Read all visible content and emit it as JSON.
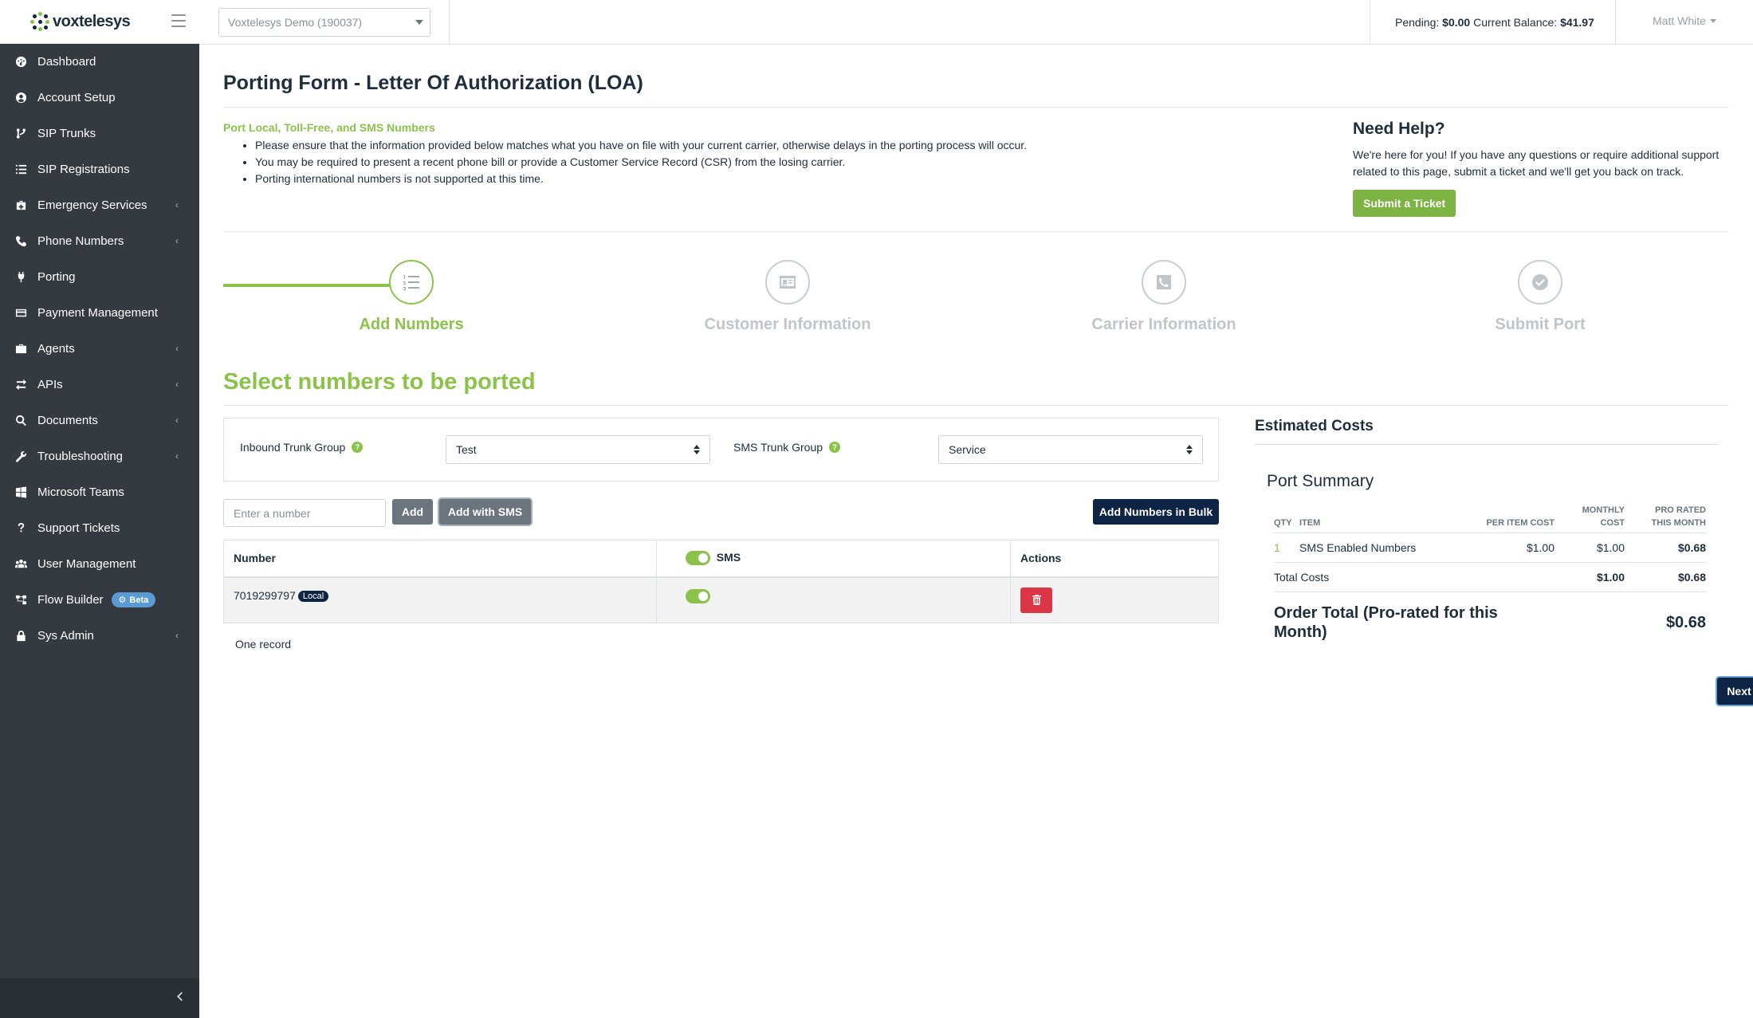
{
  "brand": {
    "name_part1": "vox",
    "name_part2": "telesys"
  },
  "sidebar": {
    "items": [
      {
        "label": "Dashboard",
        "icon": "dashboard-icon"
      },
      {
        "label": "Account Setup",
        "icon": "user-circle-icon"
      },
      {
        "label": "SIP Trunks",
        "icon": "branch-icon"
      },
      {
        "label": "SIP Registrations",
        "icon": "list-icon"
      },
      {
        "label": "Emergency Services",
        "icon": "medkit-icon",
        "expandable": true
      },
      {
        "label": "Phone Numbers",
        "icon": "phone-icon",
        "expandable": true
      },
      {
        "label": "Porting",
        "icon": "plug-icon"
      },
      {
        "label": "Payment Management",
        "icon": "credit-card-icon"
      },
      {
        "label": "Agents",
        "icon": "briefcase-icon",
        "expandable": true
      },
      {
        "label": "APIs",
        "icon": "exchange-icon",
        "expandable": true
      },
      {
        "label": "Documents",
        "icon": "search-icon",
        "expandable": true
      },
      {
        "label": "Troubleshooting",
        "icon": "wrench-icon",
        "expandable": true
      },
      {
        "label": "Microsoft Teams",
        "icon": "windows-icon"
      },
      {
        "label": "Support Tickets",
        "icon": "question-icon"
      },
      {
        "label": "User Management",
        "icon": "users-icon"
      },
      {
        "label": "Flow Builder",
        "icon": "flow-icon",
        "badge": "Beta"
      },
      {
        "label": "Sys Admin",
        "icon": "lock-icon",
        "expandable": true
      }
    ]
  },
  "topbar": {
    "account": "Voxtelesys Demo (190037)",
    "pending_label": "Pending:",
    "pending_value": "$0.00",
    "balance_label": "Current Balance:",
    "balance_value": "$41.97",
    "user": "Matt White"
  },
  "page": {
    "title": "Porting Form - Letter Of Authorization (LOA)",
    "intro_heading": "Port Local, Toll-Free, and SMS Numbers",
    "intro_points": [
      "Please ensure that the information provided below matches what you have on file with your current carrier, otherwise delays in the porting process will occur.",
      "You may be required to present a recent phone bill or provide a Customer Service Record (CSR) from the losing carrier.",
      "Porting international numbers is not supported at this time."
    ]
  },
  "help": {
    "title": "Need Help?",
    "text": "We're here for you! If you have any questions or require additional support related to this page, submit a ticket and we'll get you back on track.",
    "button": "Submit a Ticket"
  },
  "steps": [
    {
      "label": "Add Numbers",
      "icon": "list-ol-icon",
      "active": true
    },
    {
      "label": "Customer Information",
      "icon": "id-card-icon",
      "active": false
    },
    {
      "label": "Carrier Information",
      "icon": "phone-square-icon",
      "active": false
    },
    {
      "label": "Submit Port",
      "icon": "check-circle-icon",
      "active": false
    }
  ],
  "select_section": {
    "title": "Select numbers to be ported",
    "inbound_label": "Inbound Trunk Group",
    "inbound_value": "Test",
    "sms_label": "SMS Trunk Group",
    "sms_value": "Service",
    "number_placeholder": "Enter a number",
    "add_button": "Add",
    "add_sms_button": "Add with SMS",
    "bulk_button": "Add Numbers in Bulk"
  },
  "numbers_table": {
    "headers": {
      "number": "Number",
      "sms": "SMS",
      "actions": "Actions"
    },
    "rows": [
      {
        "number": "7019299797",
        "type": "Local",
        "sms": true
      }
    ],
    "record_count": "One record"
  },
  "costs": {
    "title": "Estimated Costs",
    "summary_title": "Port Summary",
    "headers": {
      "qty": "Qty",
      "item": "Item",
      "per_item": "Per Item Cost",
      "monthly": "Monthly Cost",
      "prorated": "Pro Rated This Month"
    },
    "items": [
      {
        "qty": "1",
        "item": "SMS Enabled Numbers",
        "per_item": "$1.00",
        "monthly": "$1.00",
        "prorated": "$0.68"
      }
    ],
    "total_label": "Total Costs",
    "total_monthly": "$1.00",
    "total_prorated": "$0.68",
    "order_total_label": "Order Total (Pro-rated for this Month)",
    "order_total_value": "$0.68"
  },
  "next_button": "Next",
  "colors": {
    "accent": "#8bc34a",
    "navy": "#0e2444",
    "sidebar": "#343a40",
    "danger": "#dc3545"
  }
}
